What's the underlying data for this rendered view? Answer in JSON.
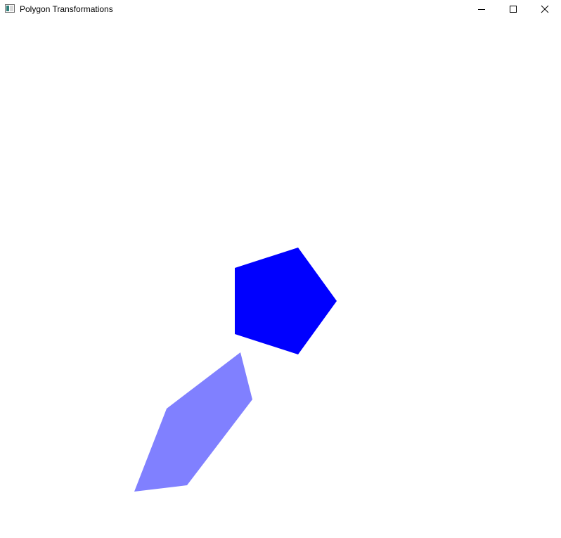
{
  "window": {
    "title": "Polygon Transformations"
  },
  "titlebar": {
    "app_icon": "app-window-icon",
    "buttons": [
      {
        "name": "minimize",
        "icon": "minimize-icon"
      },
      {
        "name": "maximize",
        "icon": "maximize-icon"
      },
      {
        "name": "close",
        "icon": "close-icon"
      }
    ]
  },
  "shapes": {
    "original_polygon_color": "#0000ff",
    "transformed_polygon_color": "#8080ff"
  }
}
